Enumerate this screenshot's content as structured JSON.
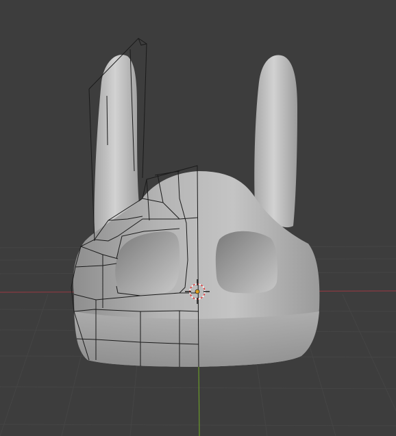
{
  "viewport": {
    "view": "3D Viewport",
    "shading": "solid",
    "grid": true,
    "x_axis_color": "#8a3a42",
    "y_axis_color": "#6a9a2a",
    "grid_color": "#4a4a4a",
    "background": "#3d3d3d"
  },
  "object": {
    "kind": "mesh",
    "description_icon": "helmet-mesh-icon",
    "mode": "sculpt-with-wireframe-overlay",
    "wire_color": "#1a1a1a",
    "surface_color": "#b8b8b8"
  },
  "cursor": {
    "icon": "3d-cursor-icon",
    "ring_color_a": "#e04040",
    "ring_color_b": "#ffffff",
    "center_color": "#e0a020"
  }
}
